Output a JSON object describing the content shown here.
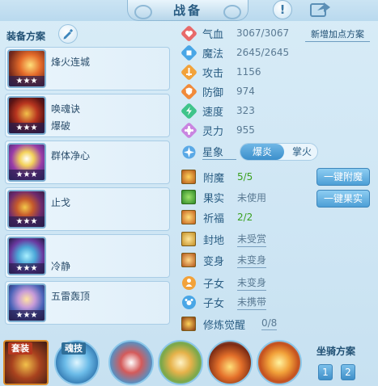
{
  "title": "战备",
  "scheme": {
    "label": "装备方案"
  },
  "equipment": [
    {
      "name": "烽火连城",
      "sub": "",
      "stars": "★★★"
    },
    {
      "name": "唤魂诀",
      "sub": "爆破",
      "stars": "★★★"
    },
    {
      "name": "群体净心",
      "sub": "",
      "stars": "★★★"
    },
    {
      "name": "止戈",
      "sub": "",
      "stars": "★★★"
    },
    {
      "name": "",
      "sub": "冷静",
      "stars": "★★★"
    },
    {
      "name": "五雷轰顶",
      "sub": "",
      "stars": "★★★"
    }
  ],
  "stats": [
    {
      "label": "气血",
      "value": "3067/3067"
    },
    {
      "label": "魔法",
      "value": "2645/2645"
    },
    {
      "label": "攻击",
      "value": "1156"
    },
    {
      "label": "防御",
      "value": "974"
    },
    {
      "label": "速度",
      "value": "323"
    },
    {
      "label": "灵力",
      "value": "955"
    }
  ],
  "add_points_scheme": "新增加点方案",
  "element": {
    "label": "星象",
    "options": [
      "爆炎",
      "掌火"
    ],
    "selected": "爆炎"
  },
  "extras": [
    {
      "label": "附魔",
      "value": "5/5"
    },
    {
      "label": "果实",
      "value": "未使用"
    },
    {
      "label": "祈福",
      "value": "2/2"
    },
    {
      "label": "封地",
      "value": "未受赏"
    },
    {
      "label": "变身",
      "value": "未变身"
    },
    {
      "label": "子女",
      "value": "未变身"
    },
    {
      "label": "子女",
      "value": "未携带"
    },
    {
      "label": "修炼觉醒",
      "value": "0/8"
    }
  ],
  "actions": {
    "enchant": "一键附魔",
    "fruit": "一键果实"
  },
  "bottom": {
    "suit": "套装",
    "soul_skill": "魂技",
    "mount_scheme": "坐骑方案",
    "mount_options": [
      "1",
      "2"
    ]
  },
  "colors": {
    "accent": "#4d9fd6",
    "panel": "#e0eff9",
    "border": "#a9cde6",
    "green": "#3aa01f"
  }
}
